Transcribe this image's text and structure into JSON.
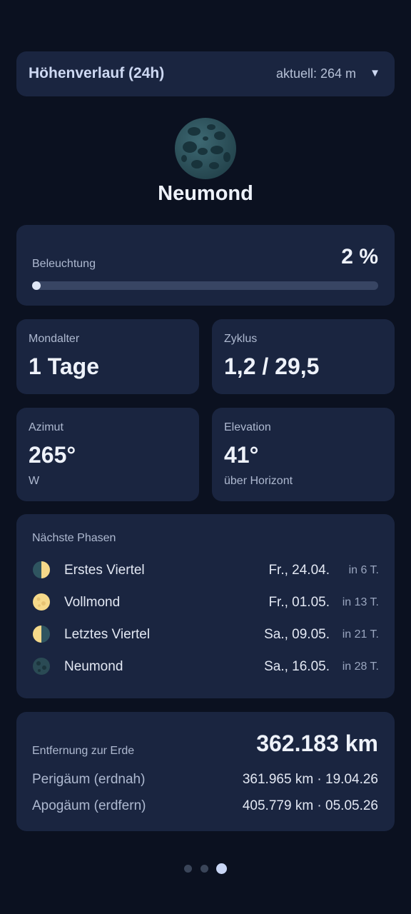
{
  "header": {
    "title": "Höhenverlauf (24h)",
    "current": "aktuell: 264 m",
    "chevron": "▼"
  },
  "moon": {
    "phase_name": "Neumond"
  },
  "illumination": {
    "label": "Beleuchtung",
    "value": "2 %",
    "fraction": 0.02
  },
  "stats": {
    "age": {
      "label": "Mondalter",
      "value": "1 Tage"
    },
    "cycle": {
      "label": "Zyklus",
      "value": "1,2 / 29,5"
    },
    "azimuth": {
      "label": "Azimut",
      "value": "265°",
      "sub": "W"
    },
    "elevation": {
      "label": "Elevation",
      "value": "41°",
      "sub": "über Horizont"
    }
  },
  "next_phases": {
    "label": "Nächste Phasen",
    "items": [
      {
        "icon": "first-quarter-icon",
        "name": "Erstes Viertel",
        "date": "Fr., 24.04.",
        "relative": "in 6 T."
      },
      {
        "icon": "full-moon-icon",
        "name": "Vollmond",
        "date": "Fr., 01.05.",
        "relative": "in 13 T."
      },
      {
        "icon": "last-quarter-icon",
        "name": "Letztes Viertel",
        "date": "Sa., 09.05.",
        "relative": "in 21 T."
      },
      {
        "icon": "new-moon-icon",
        "name": "Neumond",
        "date": "Sa., 16.05.",
        "relative": "in 28 T."
      }
    ]
  },
  "distance": {
    "label": "Entfernung zur Erde",
    "value": "362.183 km",
    "perigee_label": "Perigäum (erdnah)",
    "perigee_value": "361.965 km · 19.04.26",
    "apogee_label": "Apogäum (erdfern)",
    "apogee_value": "405.779 km · 05.05.26"
  },
  "pager": {
    "pages": 3,
    "active": 3
  },
  "colors": {
    "background": "#0b1120",
    "card": "#1a2540",
    "accent": "#dfe6f5",
    "moon_dark": "#2f5560",
    "moon_light": "#f5d98a"
  }
}
